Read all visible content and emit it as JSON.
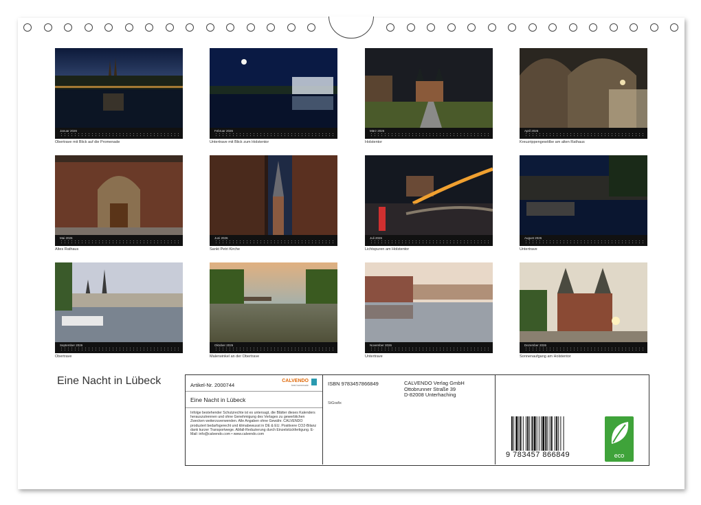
{
  "title": "Eine Nacht in Lübeck",
  "months": [
    {
      "label": "Januar 2026",
      "caption": "Obertrave mit Blick auf die Promenade"
    },
    {
      "label": "Februar 2026",
      "caption": "Untertrave mit Blick zum Holstentor"
    },
    {
      "label": "März 2026",
      "caption": "Holstentor"
    },
    {
      "label": "April 2026",
      "caption": "Kreuzrippengewölbe am alten Rathaus"
    },
    {
      "label": "Mai 2026",
      "caption": "Altes Rathaus"
    },
    {
      "label": "Juni 2026",
      "caption": "Sankt Petri Kirche"
    },
    {
      "label": "Juli 2026",
      "caption": "Lichtspuren am Holstentor"
    },
    {
      "label": "August 2026",
      "caption": "Untertrave"
    },
    {
      "label": "September 2026",
      "caption": "Obertrave"
    },
    {
      "label": "Oktober 2026",
      "caption": "Malerwinkel an der Obertrave"
    },
    {
      "label": "November 2026",
      "caption": "Untertrave"
    },
    {
      "label": "Dezember 2026",
      "caption": "Sonnenaufgang am Holstentor"
    }
  ],
  "info": {
    "article": "Artikel-Nr. 2000744",
    "brand": "CALVENDO",
    "brand_sub": "best homemade",
    "title": "Eine Nacht in Lübeck",
    "legal": "Infolge bestehender Schutzrechte ist es untersagt, die Blätter dieses Kalenders herauszutrennen und ohne Genehmigung des Verlages zu gewerblichen Zwecken weiterzuverwenden. Alle Angaben ohne Gewähr. CALVENDO produziert bedarfsgerecht und klimabewusst in DE & EU. Positivere CO2-Bilanz dank kurzer Transportwege. Abfall-Reduzierung durch Einzelstückfertigung. E-Mail: info@calvendo.com • www.calvendo.com",
    "isbn": "ISBN 9783457866849",
    "grafix": "StGrafix",
    "publisher": [
      "CALVENDO Verlag GmbH",
      "Ottobrunner Straße 39",
      "D-82008 Unterhaching"
    ],
    "barcode_number": "9 783457 866849",
    "eco_label": "eco"
  },
  "colors": {
    "calendar_bar": "#111111",
    "eco_green": "#3fa33a",
    "brand_orange": "#e06a0a"
  }
}
